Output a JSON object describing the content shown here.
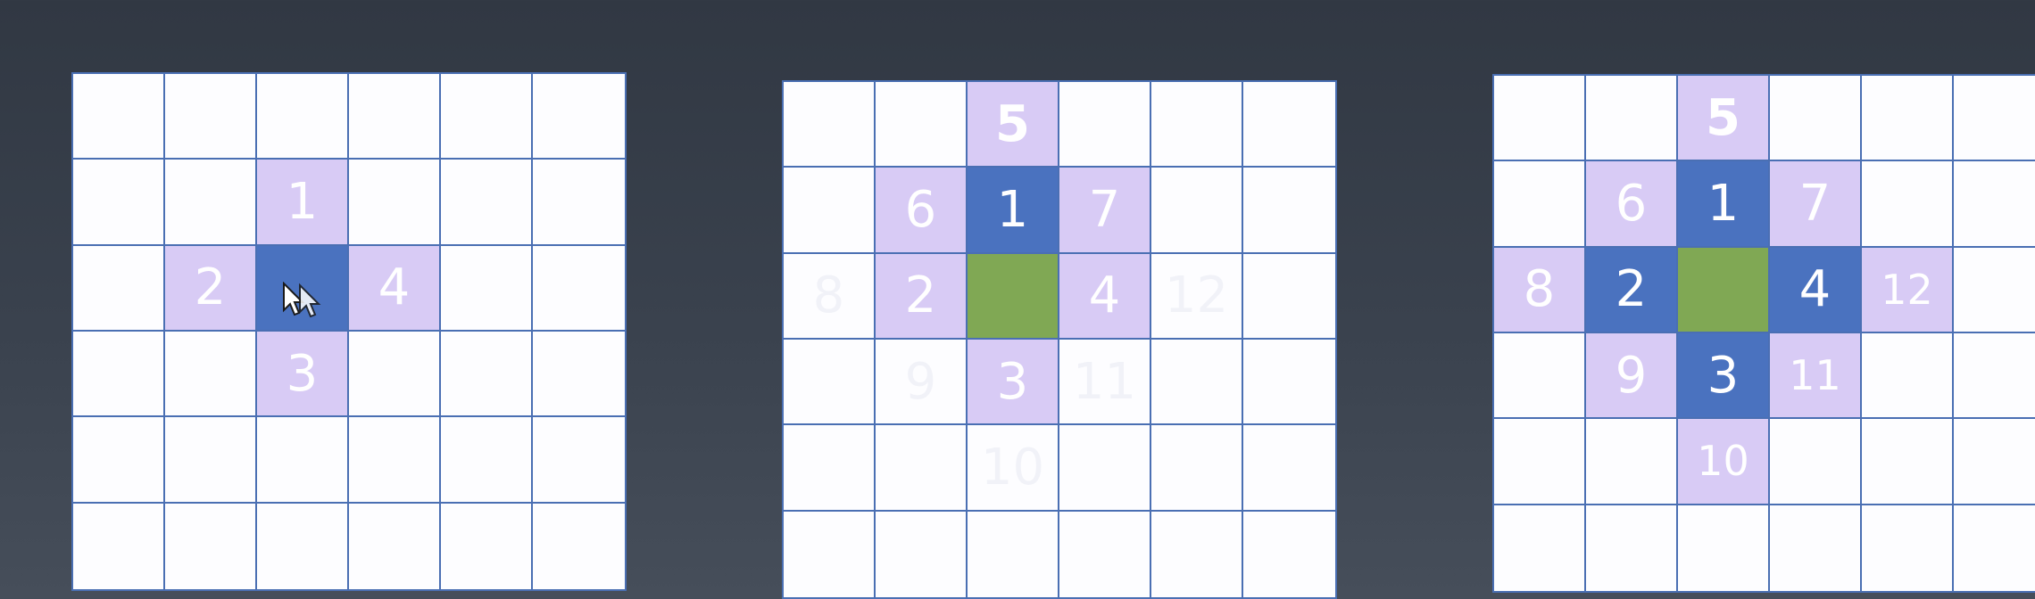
{
  "colors": {
    "grid_line": "#4a6fb3",
    "empty": "#fdfdff",
    "neighbor": "#d8cbf5",
    "active": "#4a72bf",
    "center": "#80a854",
    "background": "#3a424e"
  },
  "grids": [
    {
      "cells": [
        {
          "row": 1,
          "col": 2,
          "label": "1",
          "state": "neighbor"
        },
        {
          "row": 2,
          "col": 1,
          "label": "2",
          "state": "neighbor"
        },
        {
          "row": 2,
          "col": 2,
          "label": "",
          "state": "active",
          "icon": "cursor-icon"
        },
        {
          "row": 2,
          "col": 3,
          "label": "4",
          "state": "neighbor"
        },
        {
          "row": 3,
          "col": 2,
          "label": "3",
          "state": "neighbor"
        }
      ]
    },
    {
      "cells": [
        {
          "row": 0,
          "col": 2,
          "label": "5",
          "state": "neighbor",
          "bold": true
        },
        {
          "row": 1,
          "col": 1,
          "label": "6",
          "state": "neighbor"
        },
        {
          "row": 1,
          "col": 2,
          "label": "1",
          "state": "active"
        },
        {
          "row": 1,
          "col": 3,
          "label": "7",
          "state": "neighbor"
        },
        {
          "row": 2,
          "col": 0,
          "label": "8",
          "state": "ghost"
        },
        {
          "row": 2,
          "col": 1,
          "label": "2",
          "state": "neighbor"
        },
        {
          "row": 2,
          "col": 2,
          "label": "",
          "state": "center"
        },
        {
          "row": 2,
          "col": 3,
          "label": "4",
          "state": "neighbor"
        },
        {
          "row": 2,
          "col": 4,
          "label": "12",
          "state": "ghost"
        },
        {
          "row": 3,
          "col": 1,
          "label": "9",
          "state": "ghost"
        },
        {
          "row": 3,
          "col": 2,
          "label": "3",
          "state": "neighbor"
        },
        {
          "row": 3,
          "col": 3,
          "label": "11",
          "state": "ghost"
        },
        {
          "row": 4,
          "col": 2,
          "label": "10",
          "state": "ghost"
        }
      ]
    },
    {
      "cells": [
        {
          "row": 0,
          "col": 2,
          "label": "5",
          "state": "neighbor",
          "bold": true
        },
        {
          "row": 1,
          "col": 1,
          "label": "6",
          "state": "neighbor"
        },
        {
          "row": 1,
          "col": 2,
          "label": "1",
          "state": "active"
        },
        {
          "row": 1,
          "col": 3,
          "label": "7",
          "state": "neighbor"
        },
        {
          "row": 2,
          "col": 0,
          "label": "8",
          "state": "neighbor"
        },
        {
          "row": 2,
          "col": 1,
          "label": "2",
          "state": "active"
        },
        {
          "row": 2,
          "col": 2,
          "label": "",
          "state": "center"
        },
        {
          "row": 2,
          "col": 3,
          "label": "4",
          "state": "active"
        },
        {
          "row": 2,
          "col": 4,
          "label": "12",
          "state": "neighbor",
          "small": true
        },
        {
          "row": 3,
          "col": 1,
          "label": "9",
          "state": "neighbor"
        },
        {
          "row": 3,
          "col": 2,
          "label": "3",
          "state": "active"
        },
        {
          "row": 3,
          "col": 3,
          "label": "11",
          "state": "neighbor",
          "small": true
        },
        {
          "row": 4,
          "col": 2,
          "label": "10",
          "state": "neighbor",
          "small": true
        }
      ]
    }
  ]
}
